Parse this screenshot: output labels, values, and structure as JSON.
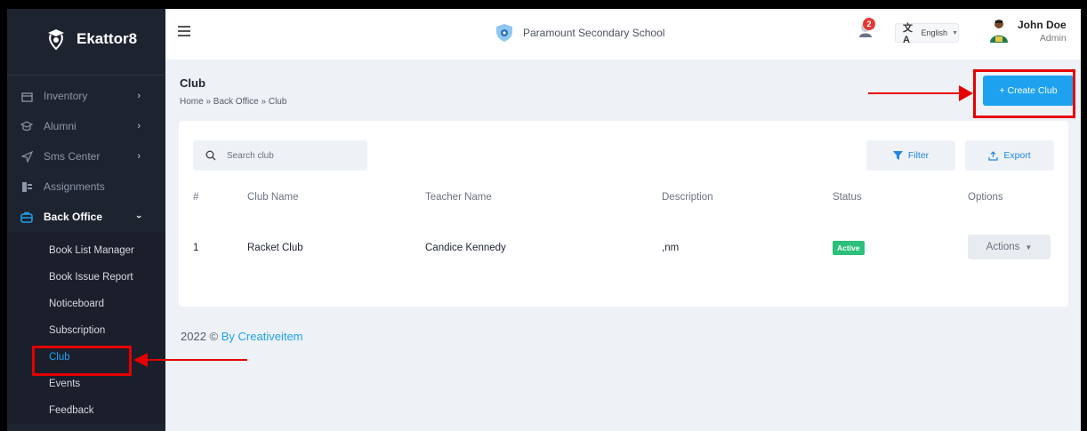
{
  "brand": {
    "name": "Ekattor8"
  },
  "sidebar": {
    "items": [
      {
        "label": "Inventory",
        "icon": "inventory-icon",
        "chevron": "›"
      },
      {
        "label": "Alumni",
        "icon": "graduation-cap-icon",
        "chevron": "›"
      },
      {
        "label": "Sms Center",
        "icon": "send-icon",
        "chevron": "›"
      },
      {
        "label": "Assignments",
        "icon": "assignments-icon",
        "chevron": ""
      },
      {
        "label": "Back Office",
        "icon": "briefcase-icon",
        "chevron": "›"
      }
    ],
    "back_office_sub": [
      "Book List Manager",
      "Book Issue Report",
      "Noticeboard",
      "Subscription",
      "Club",
      "Events",
      "Feedback"
    ]
  },
  "topbar": {
    "school_name": "Paramount Secondary School",
    "notification_count": "2",
    "language": "English",
    "user_name": "John Doe",
    "user_role": "Admin"
  },
  "page": {
    "title": "Club",
    "breadcrumb": "Home » Back Office » Club",
    "create_button": "+ Create Club"
  },
  "toolbar": {
    "search_placeholder": "Search club",
    "filter_label": "Filter",
    "export_label": "Export"
  },
  "table": {
    "headers": [
      "#",
      "Club Name",
      "Teacher Name",
      "Description",
      "Status",
      "Options"
    ],
    "rows": [
      {
        "num": "1",
        "club_name": "Racket Club",
        "teacher": "Candice Kennedy",
        "description": ",nm",
        "status": "Active",
        "options": "Actions"
      }
    ]
  },
  "footer": {
    "text": "2022 ©",
    "link": "By Creativeitem"
  },
  "colors": {
    "sidebar_bg": "#1e2330",
    "accent": "#1ea2f0",
    "status_active": "#2bbf7a",
    "annotation": "#e60000"
  }
}
